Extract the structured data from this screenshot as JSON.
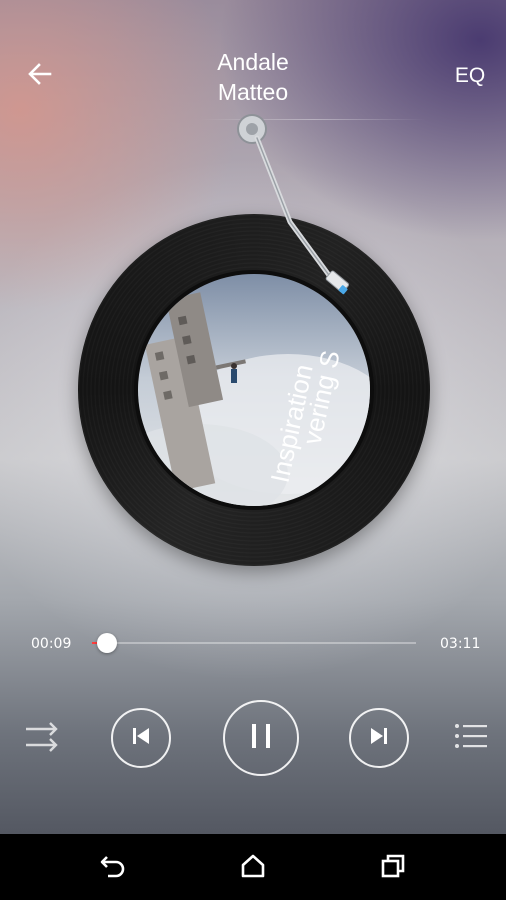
{
  "header": {
    "back_icon": "arrow-left-icon",
    "title_line1": "Andale",
    "title_line2": "Matteo",
    "eq_label": "EQ"
  },
  "album": {
    "art_text_line1": "Inspiration",
    "art_text_line2": "vering S"
  },
  "playback": {
    "elapsed": "00:09",
    "total": "03:11",
    "progress_fraction": 0.047,
    "state": "playing",
    "accent_color": "#ff3b3b"
  },
  "controls": {
    "shuffle_icon": "shuffle-icon",
    "previous_icon": "skip-previous-icon",
    "pause_icon": "pause-icon",
    "next_icon": "skip-next-icon",
    "playlist_icon": "playlist-icon"
  },
  "system_nav": {
    "back_icon": "back-icon",
    "home_icon": "home-icon",
    "recents_icon": "recents-icon"
  }
}
